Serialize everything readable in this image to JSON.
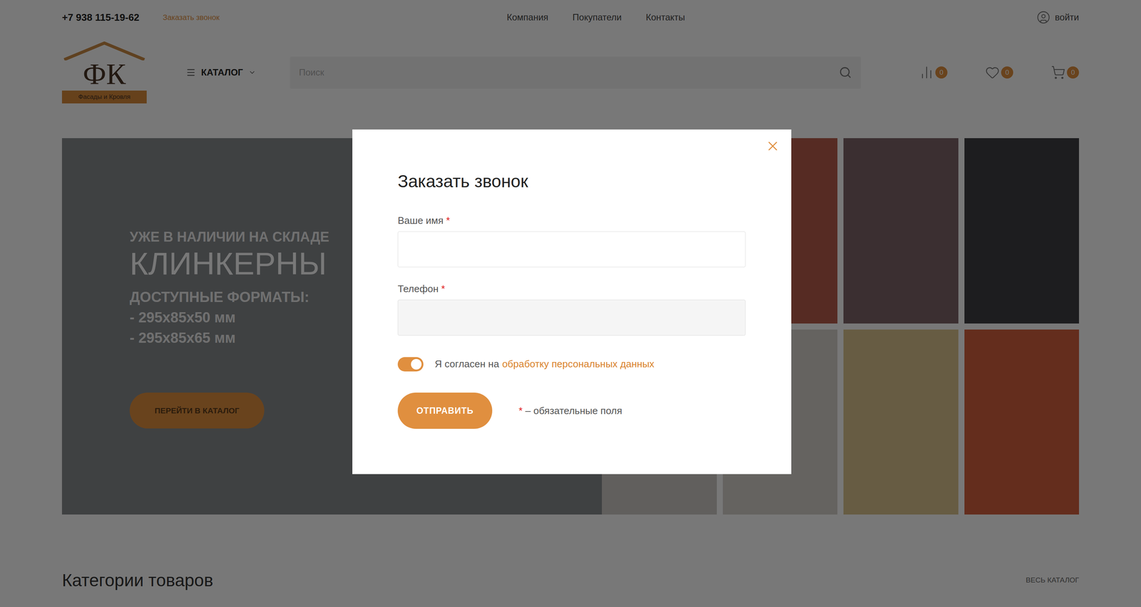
{
  "header": {
    "phone": "+7 938 115-19-62",
    "callback": "Заказать звонок",
    "nav": [
      "Компания",
      "Покупатели",
      "Контакты"
    ],
    "login": "войти"
  },
  "logo": {
    "letters": "ФК",
    "tagline": "Фасады и Кровля"
  },
  "catalog": "КАТАЛОГ",
  "search": {
    "placeholder": "Поиск"
  },
  "counters": [
    {
      "name": "compare",
      "count": "0"
    },
    {
      "name": "favorites",
      "count": "0"
    },
    {
      "name": "cart",
      "count": "0"
    }
  ],
  "banner": {
    "kicker": "УЖЕ В НАЛИЧИИ НА СКЛАДЕ",
    "title": "КЛИНКЕРНЫ",
    "subtitle": "ДОСТУПНЫЕ ФОРМАТЫ:",
    "formats": [
      "- 295х85х50 мм",
      "- 295х85х65 мм"
    ],
    "button": "ПЕРЕЙТИ В КАТАЛОГ"
  },
  "categories": {
    "title": "Категории товаров",
    "all": "ВЕСЬ КАТАЛОГ"
  },
  "modal": {
    "title": "Заказать звонок",
    "fields": [
      {
        "label": "Ваше имя",
        "required": "*",
        "value": "",
        "focused": true
      },
      {
        "label": "Телефон",
        "required": "*",
        "value": "",
        "focused": false
      }
    ],
    "consent": {
      "text": "Я согласен на",
      "link": "обработку персональных данных",
      "on": true
    },
    "submit": "ОТПРАВИТЬ",
    "note": {
      "mark": "*",
      "text": "– обязательные поля"
    }
  }
}
